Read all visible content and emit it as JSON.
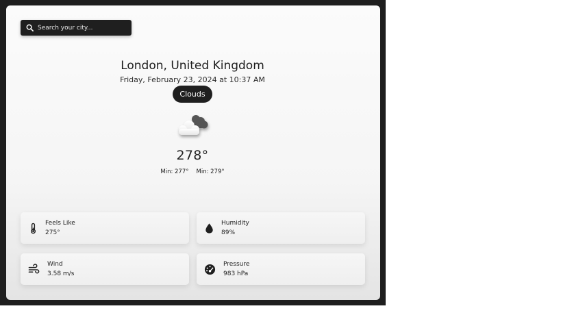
{
  "search": {
    "placeholder": "Search your city..."
  },
  "location": {
    "name": "London, United Kingdom",
    "datetime": "Friday, February 23, 2024 at 10:37 AM"
  },
  "condition": {
    "label": "Clouds",
    "icon": "cloud-icon"
  },
  "temperature": {
    "current": "278°",
    "min": "Min: 277°",
    "max": "Min: 279°"
  },
  "details": [
    {
      "label": "Feels Like",
      "value": "275°",
      "icon": "thermometer-icon"
    },
    {
      "label": "Humidity",
      "value": "89%",
      "icon": "water-drop-icon"
    },
    {
      "label": "Wind",
      "value": "3.58 m/s",
      "icon": "wind-icon"
    },
    {
      "label": "Pressure",
      "value": "983 hPa",
      "icon": "gauge-icon"
    }
  ],
  "colors": {
    "frame": "#1e1e1e",
    "accent_dark": "#1f1f1f",
    "text": "#1b1b1b"
  }
}
